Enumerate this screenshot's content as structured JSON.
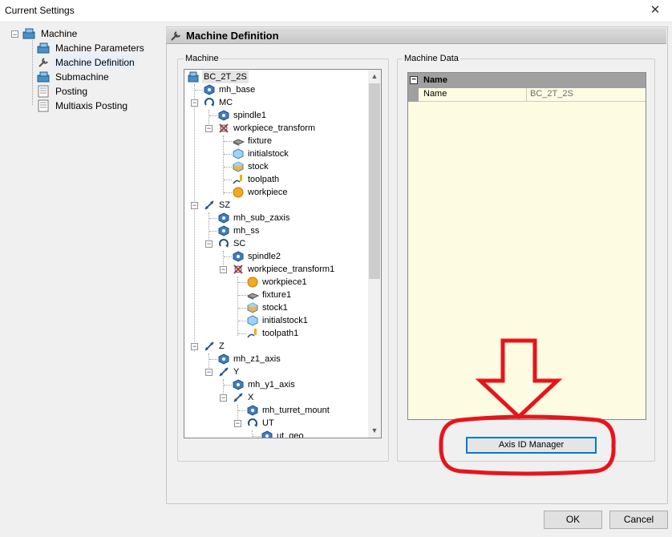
{
  "window": {
    "title": "Current Settings",
    "close_glyph": "✕"
  },
  "nav": {
    "items": [
      {
        "label": "Machine",
        "icon": "machine-icon"
      },
      {
        "label": "Machine Parameters",
        "icon": "machine-parameters-icon"
      },
      {
        "label": "Machine Definition",
        "icon": "wrench-icon",
        "selected": true
      },
      {
        "label": "Submachine",
        "icon": "submachine-icon"
      },
      {
        "label": "Posting",
        "icon": "posting-icon"
      },
      {
        "label": "Multiaxis Posting",
        "icon": "multiaxis-posting-icon"
      }
    ]
  },
  "panel": {
    "title": "Machine Definition"
  },
  "machine_group": {
    "label": "Machine"
  },
  "machine_data_group": {
    "label": "Machine Data"
  },
  "tree": {
    "nodes": [
      {
        "label": "BC_2T_2S",
        "icon": "machine-icon",
        "level": 0
      },
      {
        "label": "mh_base",
        "icon": "machine-head-icon",
        "level": 1
      },
      {
        "label": "MC",
        "icon": "rotary-axis-icon",
        "level": 1
      },
      {
        "label": "spindle1",
        "icon": "spindle-icon",
        "level": 2
      },
      {
        "label": "workpiece_transform",
        "icon": "workpiece-transform-icon",
        "level": 2
      },
      {
        "label": "fixture",
        "icon": "fixture-icon",
        "level": 3
      },
      {
        "label": "initialstock",
        "icon": "initialstock-icon",
        "level": 3
      },
      {
        "label": "stock",
        "icon": "stock-icon",
        "level": 3
      },
      {
        "label": "toolpath",
        "icon": "toolpath-icon",
        "level": 3
      },
      {
        "label": "workpiece",
        "icon": "workpiece-icon",
        "level": 3
      },
      {
        "label": "SZ",
        "icon": "linear-axis-icon",
        "level": 1
      },
      {
        "label": "mh_sub_zaxis",
        "icon": "machine-head-icon",
        "level": 2
      },
      {
        "label": "mh_ss",
        "icon": "machine-head-icon",
        "level": 2
      },
      {
        "label": "SC",
        "icon": "rotary-axis-icon",
        "level": 2
      },
      {
        "label": "spindle2",
        "icon": "spindle-icon",
        "level": 3
      },
      {
        "label": "workpiece_transform1",
        "icon": "workpiece-transform-icon",
        "level": 3
      },
      {
        "label": "workpiece1",
        "icon": "workpiece-icon",
        "level": 4
      },
      {
        "label": "fixture1",
        "icon": "fixture-icon",
        "level": 4
      },
      {
        "label": "stock1",
        "icon": "stock-icon",
        "level": 4
      },
      {
        "label": "initialstock1",
        "icon": "initialstock-icon",
        "level": 4
      },
      {
        "label": "toolpath1",
        "icon": "toolpath-icon",
        "level": 4
      },
      {
        "label": "Z",
        "icon": "linear-axis-icon",
        "level": 1
      },
      {
        "label": "mh_z1_axis",
        "icon": "machine-head-icon",
        "level": 2
      },
      {
        "label": "Y",
        "icon": "linear-axis-icon",
        "level": 2
      },
      {
        "label": "mh_y1_axis",
        "icon": "machine-head-icon",
        "level": 3
      },
      {
        "label": "X",
        "icon": "linear-axis-icon",
        "level": 3
      },
      {
        "label": "mh_turret_mount",
        "icon": "machine-head-icon",
        "level": 4
      },
      {
        "label": "UT",
        "icon": "rotary-axis-icon",
        "level": 4
      },
      {
        "label": "ut_geo",
        "icon": "machine-head-icon",
        "level": 5
      }
    ]
  },
  "property_grid": {
    "category": "Name",
    "rows": [
      {
        "name": "Name",
        "value": "BC_2T_2S"
      }
    ]
  },
  "buttons": {
    "axis_id_manager": "Axis ID Manager",
    "ok": "OK",
    "cancel": "Cancel"
  },
  "annotation": {
    "color": "#e8141b"
  }
}
